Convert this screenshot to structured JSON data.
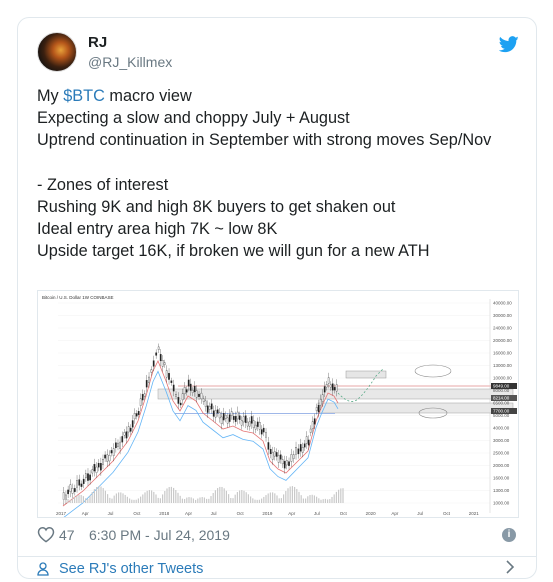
{
  "tweet": {
    "author_name": "RJ",
    "author_handle": "@RJ_Killmex",
    "text_prefix": "My ",
    "cashtag": "$BTC",
    "text_line1_rest": " macro view",
    "text_body": "\nExpecting a slow and choppy July + August\nUptrend continuation in September with strong moves Sep/Nov\n\n- Zones of interest\nRushing 9K and high 8K buyers to get shaken out\nIdeal entry area high 7K ~ low 8K\nUpside target 16K, if broken we will gun for a new ATH",
    "likes": "47",
    "timestamp": "6:30 PM - Jul 24, 2019",
    "more_tweets_label": "See RJ's other Tweets",
    "colors": {
      "link": "#2b7bb9",
      "twitter_blue": "#1da1f2",
      "muted": "#697882"
    }
  },
  "chart_image": {
    "header_text": "Bitcoin / U.S. Dollar  1W  COINBASE",
    "x_labels": [
      "2017",
      "Apr",
      "Jul",
      "Oct",
      "2018",
      "Apr",
      "Jul",
      "Oct",
      "2019",
      "Apr",
      "Jul",
      "Oct",
      "2020",
      "Apr",
      "Jul",
      "Oct",
      "2021"
    ],
    "y_labels": [
      "40000.00",
      "30000.00",
      "24000.00",
      "20000.00",
      "16000.00",
      "13000.00",
      "10000.00",
      "8000.00",
      "6500.00",
      "5000.00",
      "4000.00",
      "3000.00",
      "2500.00",
      "2000.00",
      "1600.00",
      "1300.00",
      "1000.00"
    ],
    "price_tags": [
      "9849.00",
      "8214.00",
      "7700.00"
    ]
  }
}
